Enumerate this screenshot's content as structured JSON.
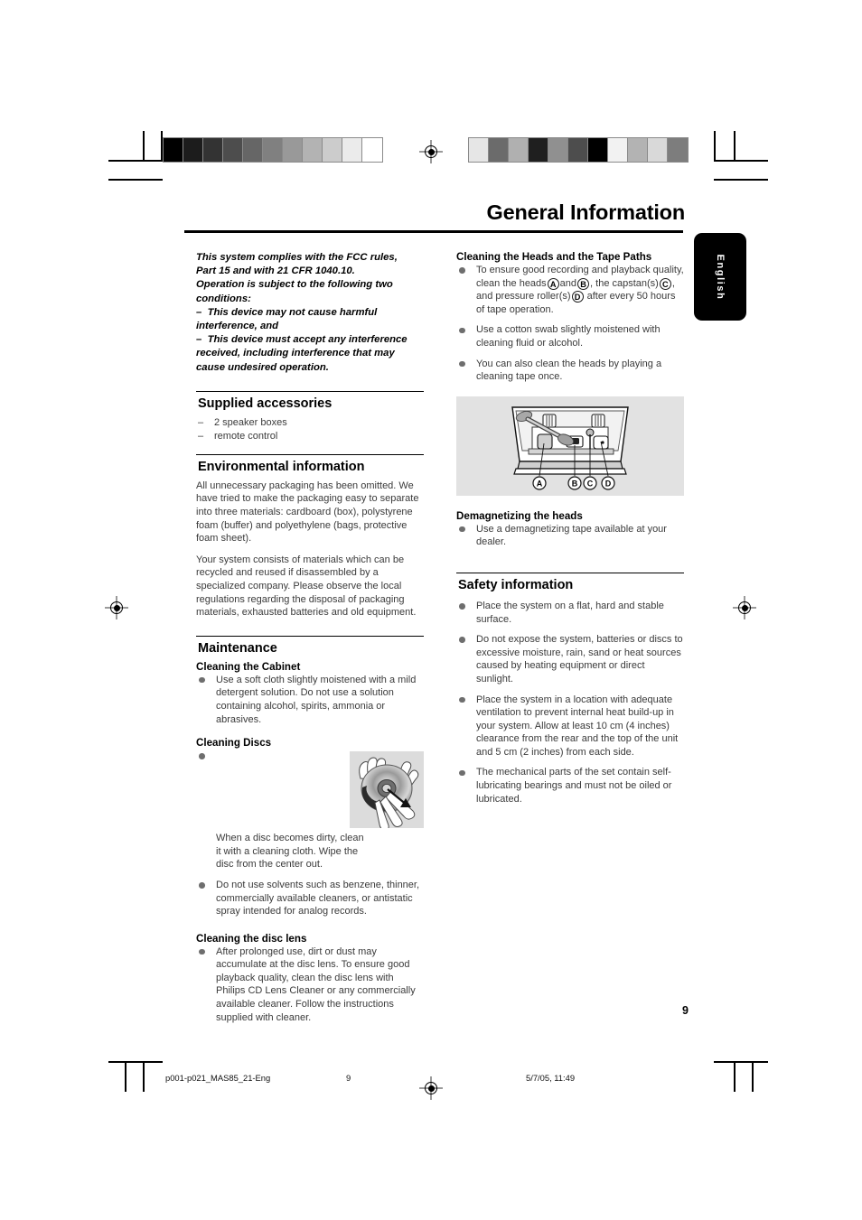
{
  "header": {
    "title": "General Information",
    "language_tab": "English"
  },
  "left_column": {
    "fcc_notice": {
      "lines": [
        "This system complies with the FCC rules,",
        "Part 15 and with 21 CFR 1040.10.",
        "Operation is subject to the following two",
        "conditions:"
      ],
      "condition_1": "This device may not cause harmful interference, and",
      "condition_2": "This device must accept any interference received, including interference that may cause undesired operation.",
      "dash": "–"
    },
    "supplied_accessories": {
      "heading": "Supplied accessories",
      "items": [
        "2 speaker boxes",
        "remote control"
      ]
    },
    "environmental_information": {
      "heading": "Environmental information",
      "paragraph_1": "All unnecessary packaging has been omitted. We have tried to make the packaging easy to separate into three materials: cardboard (box), polystyrene foam (buffer) and polyethylene (bags, protective foam sheet).",
      "paragraph_2": "Your system consists of materials which can be recycled and reused if disassembled by a specialized company. Please observe the local regulations regarding the disposal of packaging materials, exhausted batteries and old equipment."
    },
    "maintenance": {
      "heading": "Maintenance",
      "cleaning_cabinet": {
        "heading": "Cleaning the Cabinet",
        "bullets": [
          "Use a soft cloth slightly moistened with a mild detergent solution. Do not use a solution containing alcohol, spirits, ammonia or abrasives."
        ]
      },
      "cleaning_discs": {
        "heading": "Cleaning Discs",
        "bullets": [
          "When a disc becomes dirty, clean it with a cleaning cloth. Wipe the disc from the center out.",
          "Do not use solvents such as benzene, thinner, commercially available cleaners, or antistatic spray intended for analog records."
        ]
      },
      "cleaning_disc_lens": {
        "heading": "Cleaning the disc lens",
        "bullets": [
          "After prolonged use, dirt or dust may accumulate at the disc lens. To ensure good playback quality, clean the disc lens with Philips CD Lens Cleaner or any commercially available cleaner. Follow the instructions supplied with cleaner."
        ]
      }
    }
  },
  "right_column": {
    "cleaning_heads": {
      "heading": "Cleaning the Heads and the Tape Paths",
      "bullet_1_part_1": "To ensure good recording and playback quality,",
      "bullet_1_part_2": "clean the heads",
      "bullet_1_part_3": "and",
      "bullet_1_part_4": ", the capstan(s)",
      "bullet_1_part_5": ",",
      "bullet_1_part_6": "and pressure roller(s)",
      "bullet_1_part_7": "after every 50 hours of tape operation.",
      "bullets_rest": [
        "Use a cotton swab slightly moistened with cleaning fluid or alcohol.",
        "You can also clean the heads by playing a cleaning tape once."
      ],
      "figure_labels": [
        "A",
        "B",
        "C",
        "D"
      ]
    },
    "demagnetizing": {
      "heading": "Demagnetizing the heads",
      "bullets": [
        "Use a demagnetizing tape available at your dealer."
      ]
    },
    "safety_information": {
      "heading": "Safety information",
      "bullets": [
        "Place the system on a flat, hard and stable surface.",
        "Do not expose the system, batteries or discs to excessive moisture, rain, sand or heat sources caused by heating equipment or direct sunlight.",
        "Place the system in a location with adequate ventilation to prevent internal heat build-up in your system.  Allow at least 10 cm (4 inches) clearance from the rear and the top of the unit and 5 cm (2 inches) from each side.",
        "The mechanical parts of the set contain self-lubricating bearings and must not be oiled or lubricated."
      ]
    }
  },
  "footer": {
    "filename": "p001-p021_MAS85_21-Eng",
    "page_marker": "9",
    "timestamp": "5/7/05, 11:49"
  },
  "page_number": "9",
  "calibration": {
    "left_bar_swatches": [
      "#000000",
      "#1c1c1c",
      "#333333",
      "#4d4d4d",
      "#666666",
      "#808080",
      "#999999",
      "#b3b3b3",
      "#cccccc",
      "#ebebeb",
      "#ffffff"
    ],
    "right_bar_swatches": [
      "#e6e6e6",
      "#6b6b6b",
      "#b0b0b0",
      "#1f1f1f",
      "#909090",
      "#4d4d4d",
      "#000000",
      "#f2f2f2",
      "#b3b3b3",
      "#d9d9d9",
      "#7d7d7d"
    ]
  }
}
